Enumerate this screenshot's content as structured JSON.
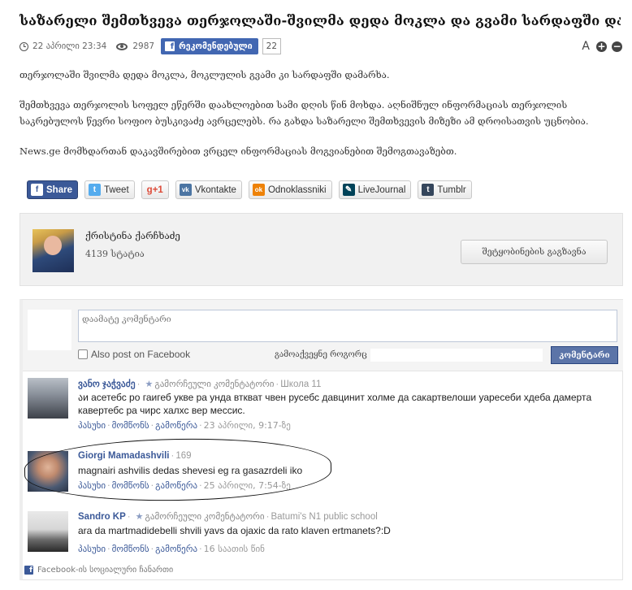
{
  "article": {
    "title": "საზარელი შემთხვევა თერჯოლაში-შვილმა დედა მოკლა და გვამი სარდაფში დამარხა",
    "date": "22 აპრილი 23:34",
    "views": "2987",
    "recommend_label": "რეკომენდებული",
    "recommend_count": "22",
    "font_size_label": "A",
    "paragraphs": [
      "თერჯოლაში შვილმა დედა მოკლა, მოკლულის გვამი კი სარდაფში დამარხა.",
      "შემთხვევა თერჯოლის სოფელ ეწერში დაახლოებით სამი დღის წინ მოხდა. აღნიშნულ ინფორმაციას თერჯოლის საკრებულოს წევრი სოფიო ბუსკივაძე ავრცელებს. რა გახდა საზარელი შემთხვევის მიზეზი ამ დროისათვის უცნობია.",
      "News.ge მომხდართან დაკავშირებით ვრცელ ინფორმაციას მოგვიანებით შემოგთავაზებთ."
    ]
  },
  "share": [
    {
      "label": "Share",
      "icon": "f",
      "color": "#3b5998"
    },
    {
      "label": "Tweet",
      "icon": "t",
      "color": "#55acee"
    },
    {
      "label": "+1",
      "icon": "g",
      "color": "#dd4b39"
    },
    {
      "label": "Vkontakte",
      "icon": "vk",
      "color": "#4c75a3"
    },
    {
      "label": "Odnoklassniki",
      "icon": "ok",
      "color": "#ee8208"
    },
    {
      "label": "LiveJournal",
      "icon": "lj",
      "color": "#004359"
    },
    {
      "label": "Tumblr",
      "icon": "t",
      "color": "#35465c"
    }
  ],
  "author": {
    "name": "ქრისტინა ქარჩხაძე",
    "stats": "4139 სტატია",
    "message_button": "შეტყობინების გაგზავნა"
  },
  "comments": {
    "input_placeholder": "დაამატე კომენტარი",
    "also_post_label": "Also post on Facebook",
    "posting_as_label": "გამოაქვეყნე როგორც",
    "submit_label": "კომენტარი",
    "items": [
      {
        "name": "ვანო ჯაჭვაძე",
        "badge": "გამორჩეული კომენტატორი",
        "affiliation": "Школа 11",
        "text": "აи асетебс ро гаигеб укве ра унда вткват чвен русебс давцинит холме да сакартвелоши уаресеби хдеба дамертa кавертебс ра чирс халхс вер мессис.",
        "reply": "პასუხი",
        "like": "მომწონს",
        "follow": "გამოწერა",
        "time": "23 აპრილი, 9:17-ზე"
      },
      {
        "name": "Giorgi Mamadashvili",
        "count": "169",
        "text": "magnairi ashvilis dedas shevesi eg ra gasazrdeli iko",
        "reply": "პასუხი",
        "like": "მომწონს",
        "follow": "გამოწერა",
        "time": "25 აპრილი, 7:54-ზე"
      },
      {
        "name": "Sandro KP",
        "badge": "გამორჩეული კომენტატორი",
        "affiliation": "Batumi's N1 public school",
        "text": "ara da martmadidebelli shvili yavs da ojaxic da rato klaven ertmanets?:D",
        "reply": "პასუხი",
        "like": "მომწონს",
        "follow": "გამოწერა",
        "time": "16 საათის წინ"
      }
    ],
    "plugin_label": "Facebook-ის სოციალური ჩანართი"
  }
}
